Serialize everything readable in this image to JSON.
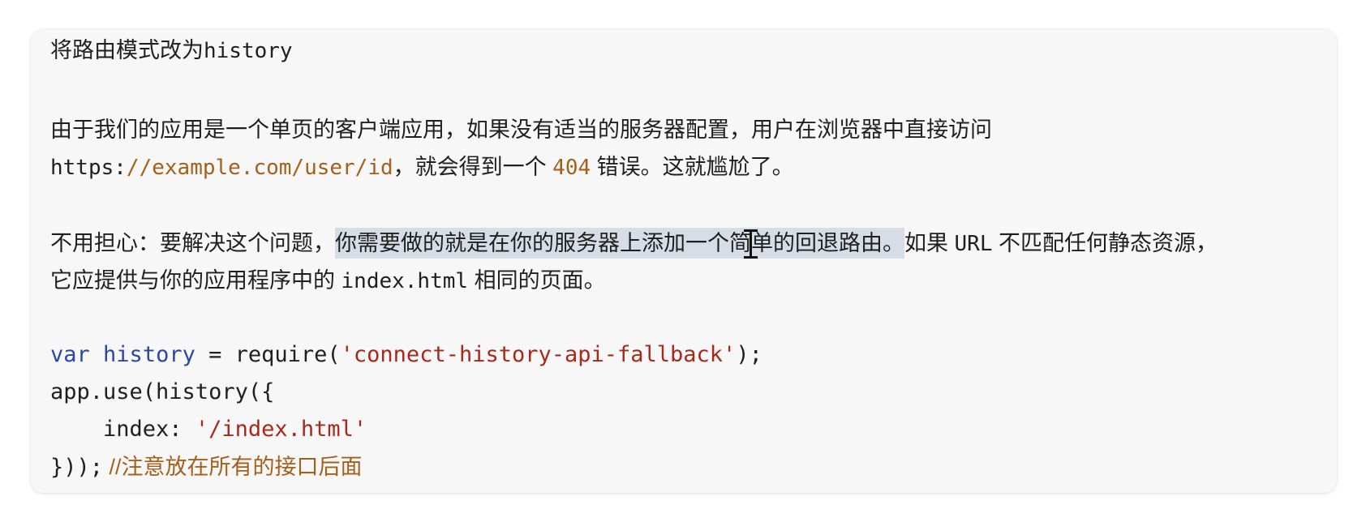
{
  "heading": {
    "prefix": "将路由模式改为",
    "code": "history"
  },
  "para1": {
    "text1": "由于我们的应用是一个单页的客户端应用，如果没有适当的服务器配置，用户在浏览器中直接访问",
    "url_scheme": "https:",
    "url_rest": "//example.com/user/id",
    "text2": "，就会得到一个 ",
    "code404": "404",
    "text3": " 错误。这就尴尬了。"
  },
  "para2": {
    "text1": "不用担心：要解决这个问题，",
    "highlight_a": "你需要做的就是在你的服务器上添加一个简",
    "highlight_b": "单的回退路由。",
    "text2": "如果 ",
    "code_url": "URL",
    "text3": " 不匹配任何静态资源，",
    "line2_a": "它应提供与你的应用程序中的 ",
    "code_index": "index.html",
    "line2_b": " 相同的页面。"
  },
  "code": {
    "l1_kw": "var",
    "l1_var": "history",
    "l1_op": " = require(",
    "l1_str": "'connect-history-api-fallback'",
    "l1_end": ");",
    "l2": "app.use(history({",
    "l3_key": "    index: ",
    "l3_str": "'/index.html'",
    "l4": "}));",
    "l4_comment": " //注意放在所有的接口后面"
  }
}
